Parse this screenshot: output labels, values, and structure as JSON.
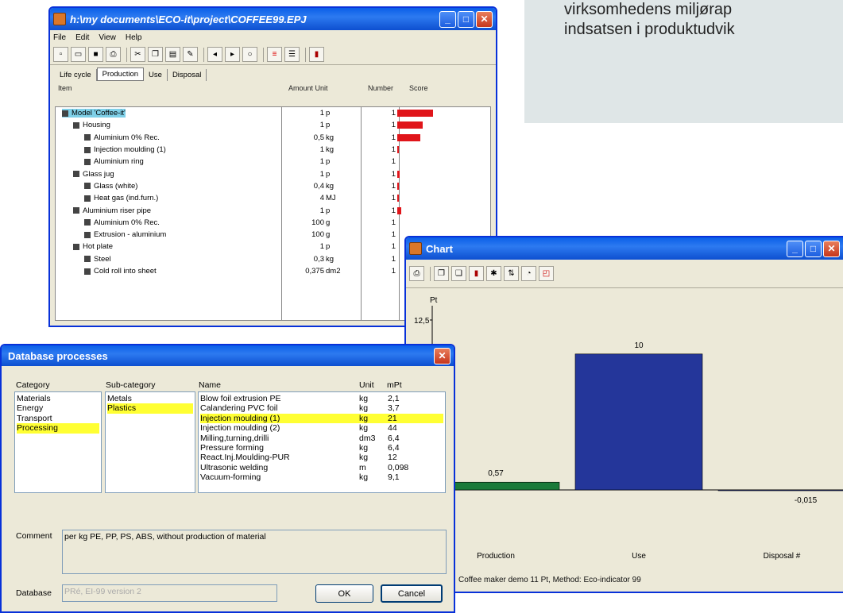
{
  "promo_text": {
    "line1": "virksomhedens miljørap",
    "line2": "indsatsen i produktudvik"
  },
  "main_window": {
    "title": "h:\\my documents\\ECO-it\\project\\COFFEE99.EPJ",
    "menu": [
      "File",
      "Edit",
      "View",
      "Help"
    ],
    "tabs": [
      "Life cycle",
      "Production",
      "Use",
      "Disposal"
    ],
    "active_tab": "Production",
    "columns": {
      "item": "Item",
      "amount_unit": "Amount Unit",
      "number": "Number",
      "score": "Score"
    },
    "rows": [
      {
        "indent": 0,
        "name": "Model 'Coffee-it'",
        "amount": "1",
        "unit": "p",
        "number": "1",
        "score": 1.0,
        "sel": true
      },
      {
        "indent": 1,
        "name": "Housing",
        "amount": "1",
        "unit": "p",
        "number": "1",
        "score": 0.7
      },
      {
        "indent": 2,
        "name": "Aluminium 0% Rec.",
        "amount": "0,5",
        "unit": "kg",
        "number": "1",
        "score": 0.65
      },
      {
        "indent": 2,
        "name": "Injection moulding (1)",
        "amount": "1",
        "unit": "kg",
        "number": "1",
        "score": 0.05
      },
      {
        "indent": 2,
        "name": "Aluminium ring",
        "amount": "1",
        "unit": "p",
        "number": "1",
        "score": 0
      },
      {
        "indent": 1,
        "name": "Glass jug",
        "amount": "1",
        "unit": "p",
        "number": "1",
        "score": 0.06
      },
      {
        "indent": 2,
        "name": "Glass (white)",
        "amount": "0,4",
        "unit": "kg",
        "number": "1",
        "score": 0.04
      },
      {
        "indent": 2,
        "name": "Heat gas (ind.furn.)",
        "amount": "4",
        "unit": "MJ",
        "number": "1",
        "score": 0.04
      },
      {
        "indent": 1,
        "name": "Aluminium riser pipe",
        "amount": "1",
        "unit": "p",
        "number": "1",
        "score": 0.1
      },
      {
        "indent": 2,
        "name": "Aluminium 0% Rec.",
        "amount": "100",
        "unit": "g",
        "number": "1",
        "score": 0
      },
      {
        "indent": 2,
        "name": "Extrusion - aluminium",
        "amount": "100",
        "unit": "g",
        "number": "1",
        "score": 0
      },
      {
        "indent": 1,
        "name": "Hot plate",
        "amount": "1",
        "unit": "p",
        "number": "1",
        "score": 0
      },
      {
        "indent": 2,
        "name": "Steel",
        "amount": "0,3",
        "unit": "kg",
        "number": "1",
        "score": 0
      },
      {
        "indent": 2,
        "name": "Cold roll into sheet",
        "amount": "0,375",
        "unit": "dm2",
        "number": "1",
        "score": 0
      }
    ]
  },
  "chart_window": {
    "title": "Chart",
    "footer": "Coffee maker demo  11 Pt,  Method: Eco-indicator 99",
    "chart_data": {
      "type": "bar",
      "ylabel": "Pt",
      "categories": [
        "Production",
        "Use",
        "Disposal #"
      ],
      "values": [
        0.57,
        10,
        -0.015
      ],
      "value_labels": [
        "0,57",
        "10",
        "-0,015"
      ],
      "ytick": "12,5",
      "colors": [
        "#1a7a3a",
        "#24369a",
        "#24369a"
      ]
    }
  },
  "db_window": {
    "title": "Database processes",
    "headers": {
      "category": "Category",
      "subcategory": "Sub-category",
      "name": "Name",
      "unit": "Unit",
      "mpt": "mPt"
    },
    "categories": [
      "Materials",
      "Energy",
      "Transport",
      "Processing"
    ],
    "selected_category": "Processing",
    "subcategories": [
      "Metals",
      "Plastics"
    ],
    "selected_subcategory": "Plastics",
    "processes": [
      {
        "name": "Blow foil extrusion PE",
        "unit": "kg",
        "mpt": "2,1"
      },
      {
        "name": "Calandering PVC foil",
        "unit": "kg",
        "mpt": "3,7"
      },
      {
        "name": "Injection moulding (1)",
        "unit": "kg",
        "mpt": "21",
        "sel": true
      },
      {
        "name": "Injection moulding (2)",
        "unit": "kg",
        "mpt": "44"
      },
      {
        "name": "Milling,turning,drilli",
        "unit": "dm3",
        "mpt": "6,4"
      },
      {
        "name": "Pressure forming",
        "unit": "kg",
        "mpt": "6,4"
      },
      {
        "name": "React.Inj.Moulding-PUR",
        "unit": "kg",
        "mpt": "12"
      },
      {
        "name": "Ultrasonic welding",
        "unit": "m",
        "mpt": "0,098"
      },
      {
        "name": "Vacuum-forming",
        "unit": "kg",
        "mpt": "9,1"
      }
    ],
    "comment_label": "Comment",
    "comment": "per kg  PE, PP, PS, ABS, without production of material",
    "database_label": "Database",
    "database_value": "PRé, EI-99 version 2",
    "ok": "OK",
    "cancel": "Cancel"
  }
}
